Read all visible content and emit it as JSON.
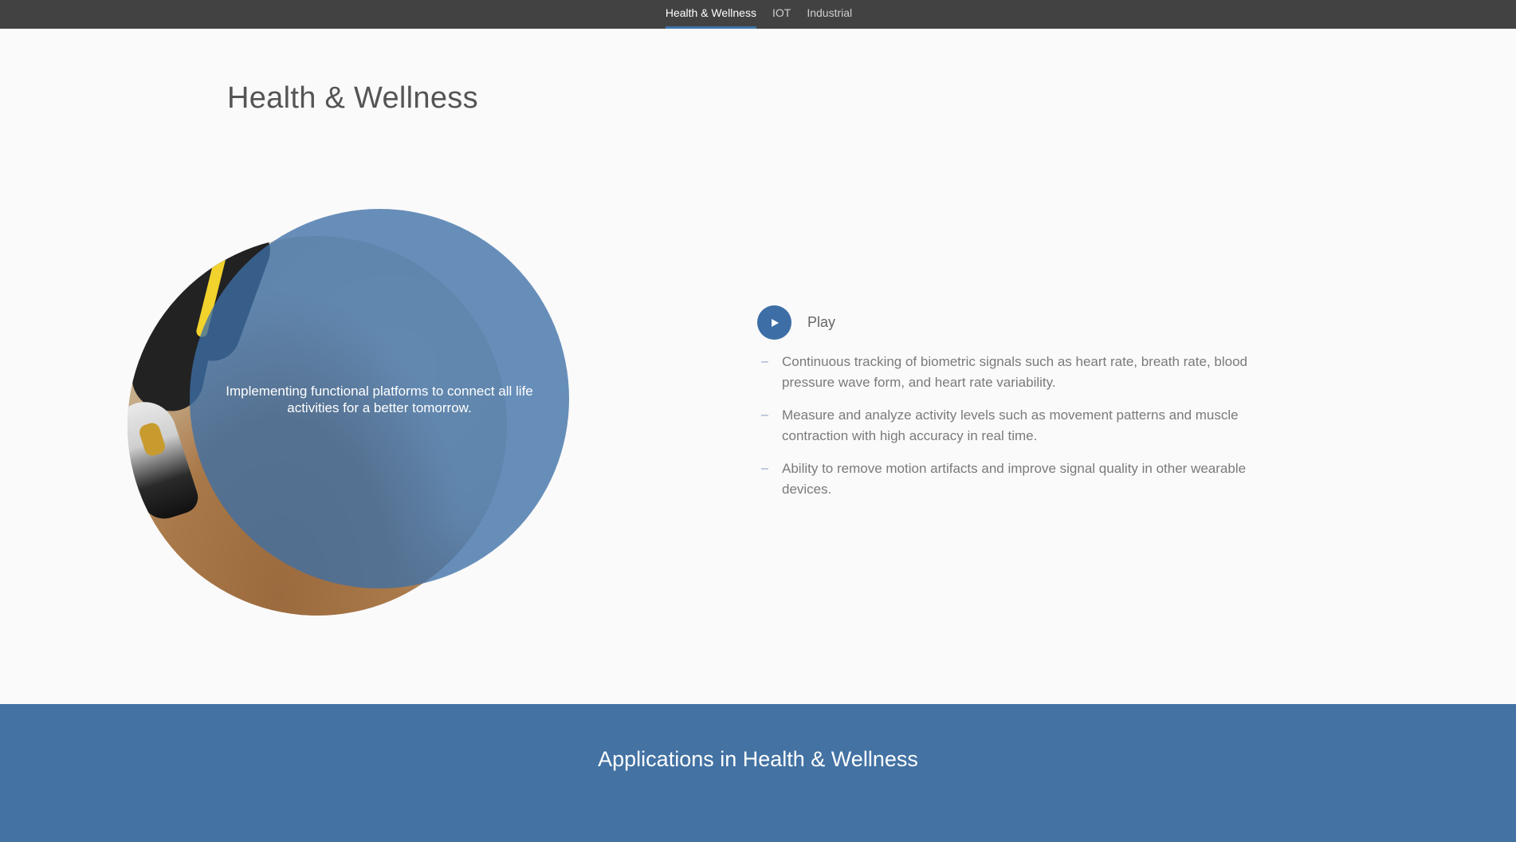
{
  "nav": {
    "tabs": [
      {
        "label": "Health & Wellness",
        "active": true
      },
      {
        "label": "IOT",
        "active": false
      },
      {
        "label": "Industrial",
        "active": false
      }
    ]
  },
  "page": {
    "title": "Health & Wellness"
  },
  "hero": {
    "caption": "Implementing functional platforms to connect all life activities for a better tomorrow."
  },
  "media": {
    "play_label": "Play",
    "play_icon": "play-icon"
  },
  "features": [
    "Continuous tracking of biometric signals such as heart rate, breath rate, blood pressure wave form, and heart rate variability.",
    "Measure and analyze activity levels such as movement patterns and muscle contraction with high accuracy in real time.",
    "Ability to remove motion artifacts and improve signal quality in other wearable devices."
  ],
  "applications": {
    "title": "Applications in Health & Wellness"
  },
  "colors": {
    "nav_bg": "#424242",
    "accent_blue": "#3f72a8",
    "band_blue": "#4372a3",
    "page_bg": "#fafafa"
  }
}
